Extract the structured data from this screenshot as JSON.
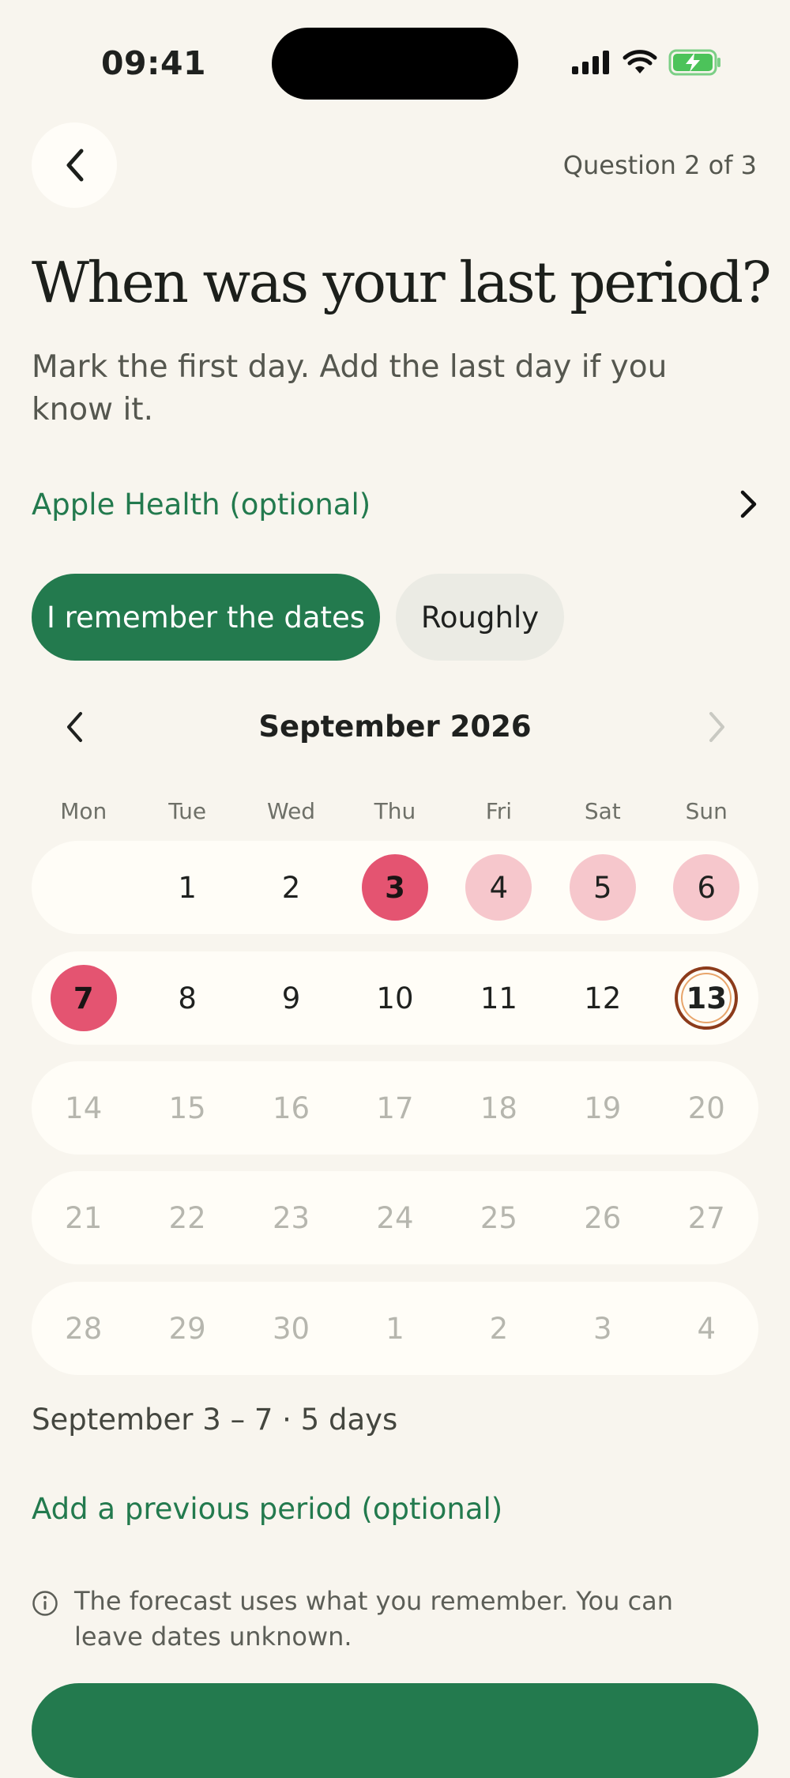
{
  "status_bar": {
    "time": "09:41"
  },
  "header": {
    "progress": "Question 2 of 3"
  },
  "question": {
    "title": "When was your last period?",
    "subtitle": "Mark the first day. Add the last day if you know it."
  },
  "health": {
    "label": "Apple Health (optional)"
  },
  "modes": {
    "active": "I remember the dates",
    "inactive": "Roughly"
  },
  "calendar": {
    "month": "September 2026",
    "weekdays": [
      "Mon",
      "Tue",
      "Wed",
      "Thu",
      "Fri",
      "Sat",
      "Sun"
    ],
    "weeks": [
      [
        "",
        "1",
        "2",
        "3",
        "4",
        "5",
        "6"
      ],
      [
        "7",
        "8",
        "9",
        "10",
        "11",
        "12",
        "13"
      ],
      [
        "14",
        "15",
        "16",
        "17",
        "18",
        "19",
        "20"
      ],
      [
        "21",
        "22",
        "23",
        "24",
        "25",
        "26",
        "27"
      ],
      [
        "28",
        "29",
        "30",
        "1",
        "2",
        "3",
        "4"
      ]
    ],
    "selected_start": "3",
    "selected_end": "7",
    "today": "13"
  },
  "summary": {
    "range": "September 3 – 7 · 5 days"
  },
  "links": {
    "previous_period": "Add a previous period (optional)"
  },
  "info": {
    "text": "The forecast uses what you remember. You can leave dates unknown."
  },
  "colors": {
    "brand_green": "#237a4e",
    "period_start": "#e45471",
    "period_mid": "#f6c7cc",
    "background": "#f8f5ee"
  }
}
